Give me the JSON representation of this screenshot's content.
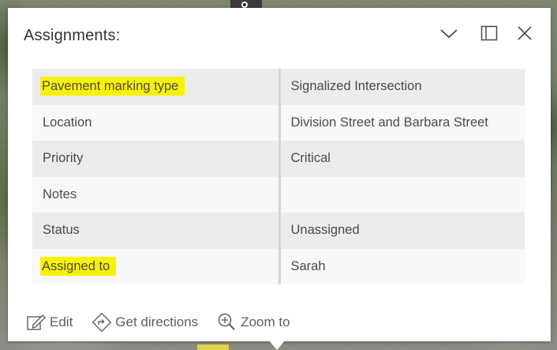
{
  "popup": {
    "title": "Assignments:",
    "collapse_icon": "chevron-down-icon",
    "dock_icon": "dock-icon",
    "close_icon": "close-icon"
  },
  "attributes": [
    {
      "field": "Pavement marking type",
      "value": "Signalized Intersection",
      "highlighted": true
    },
    {
      "field": "Location",
      "value": "Division Street and Barbara Street",
      "highlighted": false
    },
    {
      "field": "Priority",
      "value": "Critical",
      "highlighted": false
    },
    {
      "field": "Notes",
      "value": "",
      "highlighted": false
    },
    {
      "field": "Status",
      "value": "Unassigned",
      "highlighted": false
    },
    {
      "field": "Assigned to",
      "value": "Sarah",
      "highlighted": true
    }
  ],
  "actions": {
    "edit": {
      "label": "Edit",
      "icon": "edit-icon"
    },
    "directions": {
      "label": "Get directions",
      "icon": "directions-icon"
    },
    "zoom": {
      "label": "Zoom to",
      "icon": "zoom-in-icon"
    }
  },
  "colors": {
    "highlight": "#f7f200"
  }
}
